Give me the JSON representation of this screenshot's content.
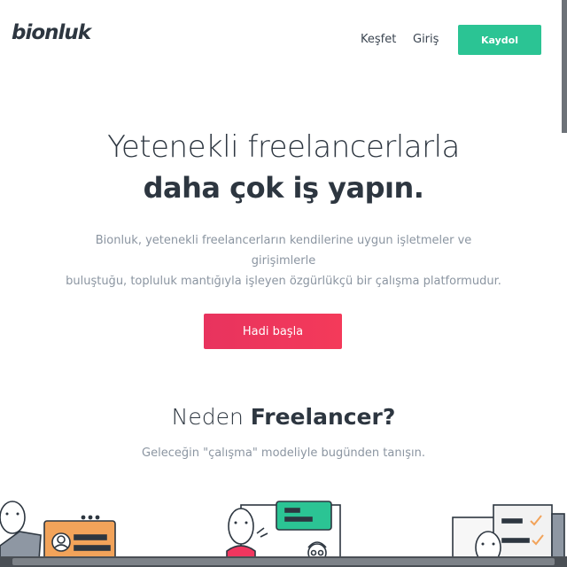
{
  "header": {
    "logo": "bionluk",
    "nav": {
      "explore": "Keşfet",
      "login": "Giriş"
    },
    "signup": "Kaydol"
  },
  "hero": {
    "line1": "Yetenekli freelancerlarla",
    "line2": "daha çok iş yapın.",
    "desc_line1": "Bionluk, yetenekli freelancerların kendilerine uygun işletmeler ve girişimlerle",
    "desc_line2": "buluştuğu, topluluk mantığıyla işleyen özgürlükçü bir çalışma platformudur.",
    "cta": "Hadi başla"
  },
  "why": {
    "title_light": "Neden ",
    "title_bold": "Freelancer?",
    "subtitle": "Geleceğin \"çalışma\" modeliyle bugünden tanışın."
  },
  "colors": {
    "accent_green": "#2bc494",
    "accent_red": "#f0365f",
    "text_dark": "#2d3640",
    "text_muted": "#8b95a1"
  }
}
